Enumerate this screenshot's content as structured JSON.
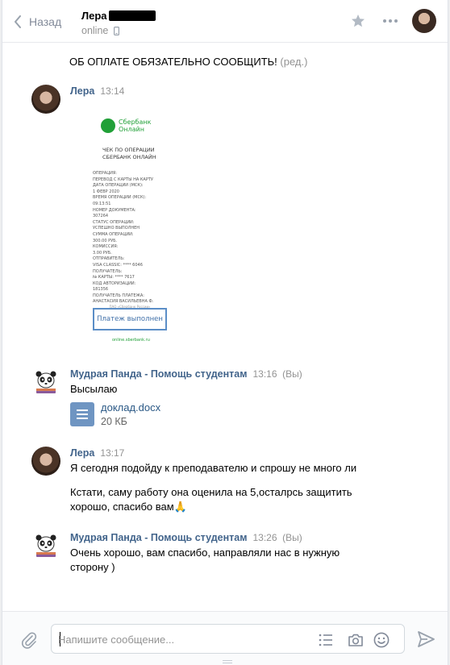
{
  "header": {
    "back_label": "Назад",
    "contact_name": "Лера",
    "status": "online"
  },
  "feed": {
    "pinned_text": "ОБ ОПЛАТЕ ОБЯЗАТЕЛЬНО СООБЩИТЬ!",
    "edited_mark": "(ред.)",
    "messages": [
      {
        "author": "Лера",
        "time": "13:14",
        "receipt": {
          "bank_line1": "Сбербанк",
          "bank_line2": "Онлайн",
          "title_line1": "ЧЕК ПО ОПЕРАЦИИ",
          "title_line2": "СБЕРБАНК ОНЛАЙН",
          "fields": "ОПЕРАЦИЯ:\nПЕРЕВОД С КАРТЫ НА КАРТУ\nДАТА ОПЕРАЦИИ (МСК):\n1 ФЕВР 2020\nВРЕМЯ ОПЕРАЦИИ (МСК):\n09:13:51\nНОМЕР ДОКУМЕНТА:\n307264\nСТАТУС ОПЕРАЦИИ:\nУСПЕШНО ВЫПОЛНЕН\nСУММА ОПЕРАЦИИ:\n300.00 РУБ.\nКОМИССИЯ:\n3.00 РУБ.\nОТПРАВИТЕЛЬ:\nVISA CLASSIC: **** 6046\nПОЛУЧАТЕЛЬ:\n№ КАРТЫ: **** 7617\nКОД АВТОРИЗАЦИИ:\n181356\nПОЛУЧАТЕЛЬ ПЛАТЕЖА:\nАНАСТАСИЯ ВАСИЛЬЕВНА Ф.",
          "stamp_small": "ПАО «Сбербанк России»",
          "stamp": "Платеж выполнен",
          "url": "online.sberbank.ru"
        }
      },
      {
        "author": "Мудрая Панда - Помощь студентам",
        "time": "13:16",
        "you_mark": "(Вы)",
        "text": "Высылаю",
        "file_name": "доклад.docx",
        "file_size": "20 КБ"
      },
      {
        "author": "Лера",
        "time": "13:17",
        "text1": "Я сегодня подойду к преподавателю и спрошу не много ли",
        "text2": "Кстати, саму работу она оценила на 5,осталрсь защитить хорошо, спасибо вам🙏"
      },
      {
        "author": "Мудрая Панда - Помощь студентам",
        "time": "13:26",
        "you_mark": "(Вы)",
        "text": "Очень хорошо, вам спасибо, направляли нас в нужную сторону )"
      }
    ]
  },
  "composer": {
    "placeholder": "Напишите сообщение..."
  },
  "icons": {
    "back": "chevron-left-icon",
    "phone": "mobile-phone-icon",
    "star": "star-icon",
    "more": "more-dots-icon",
    "attach": "paperclip-icon",
    "template": "list-icon",
    "camera": "camera-icon",
    "emoji": "smile-icon",
    "send": "send-icon"
  },
  "colors": {
    "link_name": "#42648b",
    "file_link": "#2a5885",
    "muted": "#939393",
    "sber_green": "#21a038",
    "file_icon": "#6f95c2"
  }
}
